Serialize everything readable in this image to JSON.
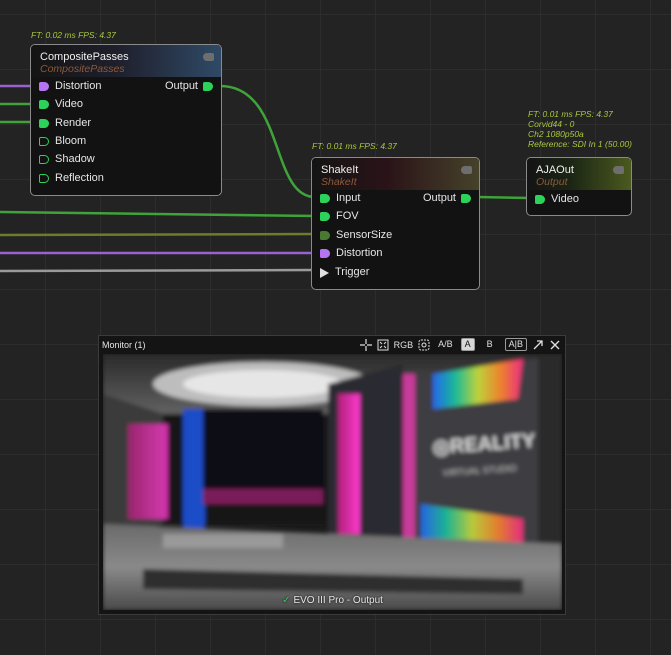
{
  "nodes": {
    "composite": {
      "stats": "FT: 0.02 ms FPS: 4.37",
      "title": "CompositePasses",
      "subtitle": "CompositePasses",
      "inputs": [
        "Distortion",
        "Video",
        "Render",
        "Bloom",
        "Shadow",
        "Reflection"
      ],
      "output": "Output"
    },
    "shakeit": {
      "stats": "FT: 0.01 ms FPS: 4.37",
      "title": "ShakeIt",
      "subtitle": "ShakeIt",
      "inputs": [
        "Input",
        "FOV",
        "SensorSize",
        "Distortion",
        "Trigger"
      ],
      "output": "Output"
    },
    "ajaout": {
      "stats": [
        "FT: 0.01 ms FPS: 4.37",
        "Corvid44 - 0",
        "Ch2 1080p50a",
        "Reference: SDI In 1 (50.00)"
      ],
      "title": "AJAOut",
      "subtitle": "Output",
      "inputs": [
        "Video"
      ]
    }
  },
  "monitor": {
    "title": "Monitor (1)",
    "tools": {
      "rgb": "RGB",
      "ab_split": "A/B",
      "a": "A",
      "b": "B",
      "ab_compare": "A|B"
    },
    "caption_icon": "check-icon",
    "caption": "EVO III Pro - Output"
  },
  "colors": {
    "background": "#232323",
    "wire_green": "#3fa33a",
    "wire_purple": "#9a62cf",
    "wire_gray": "#9a9a9a",
    "wire_olive": "#6b7d2a",
    "pin_green": "#2bd35a",
    "pin_purple": "#b774f2",
    "stats_text": "#a9c93b"
  }
}
